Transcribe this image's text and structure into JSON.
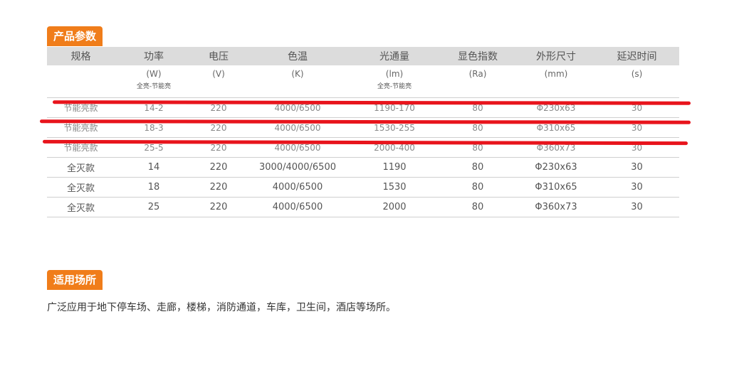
{
  "params_tag": "产品参数",
  "usage_tag": "适用场所",
  "headers": [
    "规格",
    "功率",
    "电压",
    "色温",
    "光通量",
    "显色指数",
    "外形尺寸",
    "延迟时间"
  ],
  "units": [
    {
      "main": "",
      "sub": ""
    },
    {
      "main": "(W)",
      "sub": "全亮-节能亮"
    },
    {
      "main": "(V)",
      "sub": ""
    },
    {
      "main": "(K)",
      "sub": ""
    },
    {
      "main": "(lm)",
      "sub": "全亮-节能亮"
    },
    {
      "main": "(Ra)",
      "sub": ""
    },
    {
      "main": "(mm)",
      "sub": ""
    },
    {
      "main": "(s)",
      "sub": ""
    }
  ],
  "rows": [
    {
      "struck": true,
      "cells": [
        "节能亮款",
        "14-2",
        "220",
        "4000/6500",
        "1190-170",
        "80",
        "Φ230x63",
        "30"
      ]
    },
    {
      "struck": true,
      "cells": [
        "节能亮款",
        "18-3",
        "220",
        "4000/6500",
        "1530-255",
        "80",
        "Φ310x65",
        "30"
      ]
    },
    {
      "struck": true,
      "cells": [
        "节能亮款",
        "25-5",
        "220",
        "4000/6500",
        "2000-400",
        "80",
        "Φ360x73",
        "30"
      ]
    },
    {
      "struck": false,
      "cells": [
        "全灭款",
        "14",
        "220",
        "3000/4000/6500",
        "1190",
        "80",
        "Φ230x63",
        "30"
      ]
    },
    {
      "struck": false,
      "cells": [
        "全灭款",
        "18",
        "220",
        "4000/6500",
        "1530",
        "80",
        "Φ310x65",
        "30"
      ]
    },
    {
      "struck": false,
      "cells": [
        "全灭款",
        "25",
        "220",
        "4000/6500",
        "2000",
        "80",
        "Φ360x73",
        "30"
      ]
    }
  ],
  "usage_text": "广泛应用于地下停车场、走廊，楼梯，消防通道，车库，卫生间，酒店等场所。",
  "colors": {
    "accent": "#f07d1a",
    "strike": "#e8141c",
    "header_bg": "#dcdcdc"
  }
}
